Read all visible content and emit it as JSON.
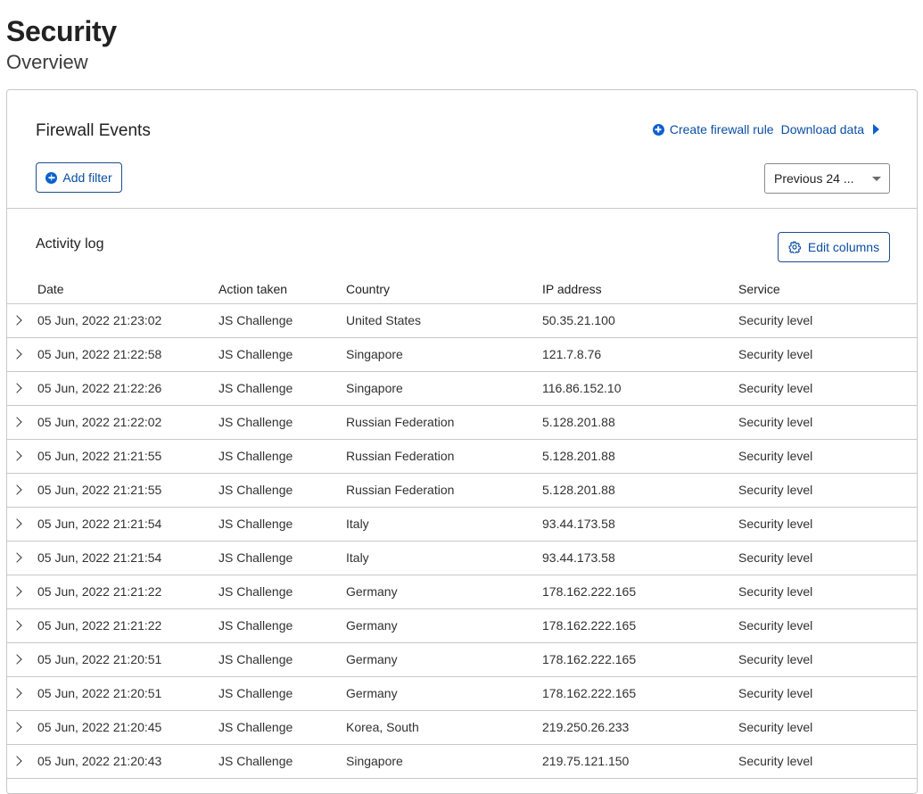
{
  "header": {
    "title": "Security",
    "subtitle": "Overview"
  },
  "firewall": {
    "title": "Firewall Events",
    "create_rule_label": "Create firewall rule",
    "download_label": "Download data",
    "add_filter_label": "Add filter",
    "time_range_label": "Previous 24 ...",
    "accent_color": "#0b5fd0"
  },
  "activity": {
    "title": "Activity log",
    "edit_columns_label": "Edit columns",
    "columns": [
      "Date",
      "Action taken",
      "Country",
      "IP address",
      "Service"
    ],
    "rows": [
      {
        "date": "05 Jun, 2022 21:23:02",
        "action": "JS Challenge",
        "country": "United States",
        "ip": "50.35.21.100",
        "service": "Security level"
      },
      {
        "date": "05 Jun, 2022 21:22:58",
        "action": "JS Challenge",
        "country": "Singapore",
        "ip": "121.7.8.76",
        "service": "Security level"
      },
      {
        "date": "05 Jun, 2022 21:22:26",
        "action": "JS Challenge",
        "country": "Singapore",
        "ip": "116.86.152.10",
        "service": "Security level"
      },
      {
        "date": "05 Jun, 2022 21:22:02",
        "action": "JS Challenge",
        "country": "Russian Federation",
        "ip": "5.128.201.88",
        "service": "Security level"
      },
      {
        "date": "05 Jun, 2022 21:21:55",
        "action": "JS Challenge",
        "country": "Russian Federation",
        "ip": "5.128.201.88",
        "service": "Security level"
      },
      {
        "date": "05 Jun, 2022 21:21:55",
        "action": "JS Challenge",
        "country": "Russian Federation",
        "ip": "5.128.201.88",
        "service": "Security level"
      },
      {
        "date": "05 Jun, 2022 21:21:54",
        "action": "JS Challenge",
        "country": "Italy",
        "ip": "93.44.173.58",
        "service": "Security level"
      },
      {
        "date": "05 Jun, 2022 21:21:54",
        "action": "JS Challenge",
        "country": "Italy",
        "ip": "93.44.173.58",
        "service": "Security level"
      },
      {
        "date": "05 Jun, 2022 21:21:22",
        "action": "JS Challenge",
        "country": "Germany",
        "ip": "178.162.222.165",
        "service": "Security level"
      },
      {
        "date": "05 Jun, 2022 21:21:22",
        "action": "JS Challenge",
        "country": "Germany",
        "ip": "178.162.222.165",
        "service": "Security level"
      },
      {
        "date": "05 Jun, 2022 21:20:51",
        "action": "JS Challenge",
        "country": "Germany",
        "ip": "178.162.222.165",
        "service": "Security level"
      },
      {
        "date": "05 Jun, 2022 21:20:51",
        "action": "JS Challenge",
        "country": "Germany",
        "ip": "178.162.222.165",
        "service": "Security level"
      },
      {
        "date": "05 Jun, 2022 21:20:45",
        "action": "JS Challenge",
        "country": "Korea, South",
        "ip": "219.250.26.233",
        "service": "Security level"
      },
      {
        "date": "05 Jun, 2022 21:20:43",
        "action": "JS Challenge",
        "country": "Singapore",
        "ip": "219.75.121.150",
        "service": "Security level"
      }
    ]
  }
}
